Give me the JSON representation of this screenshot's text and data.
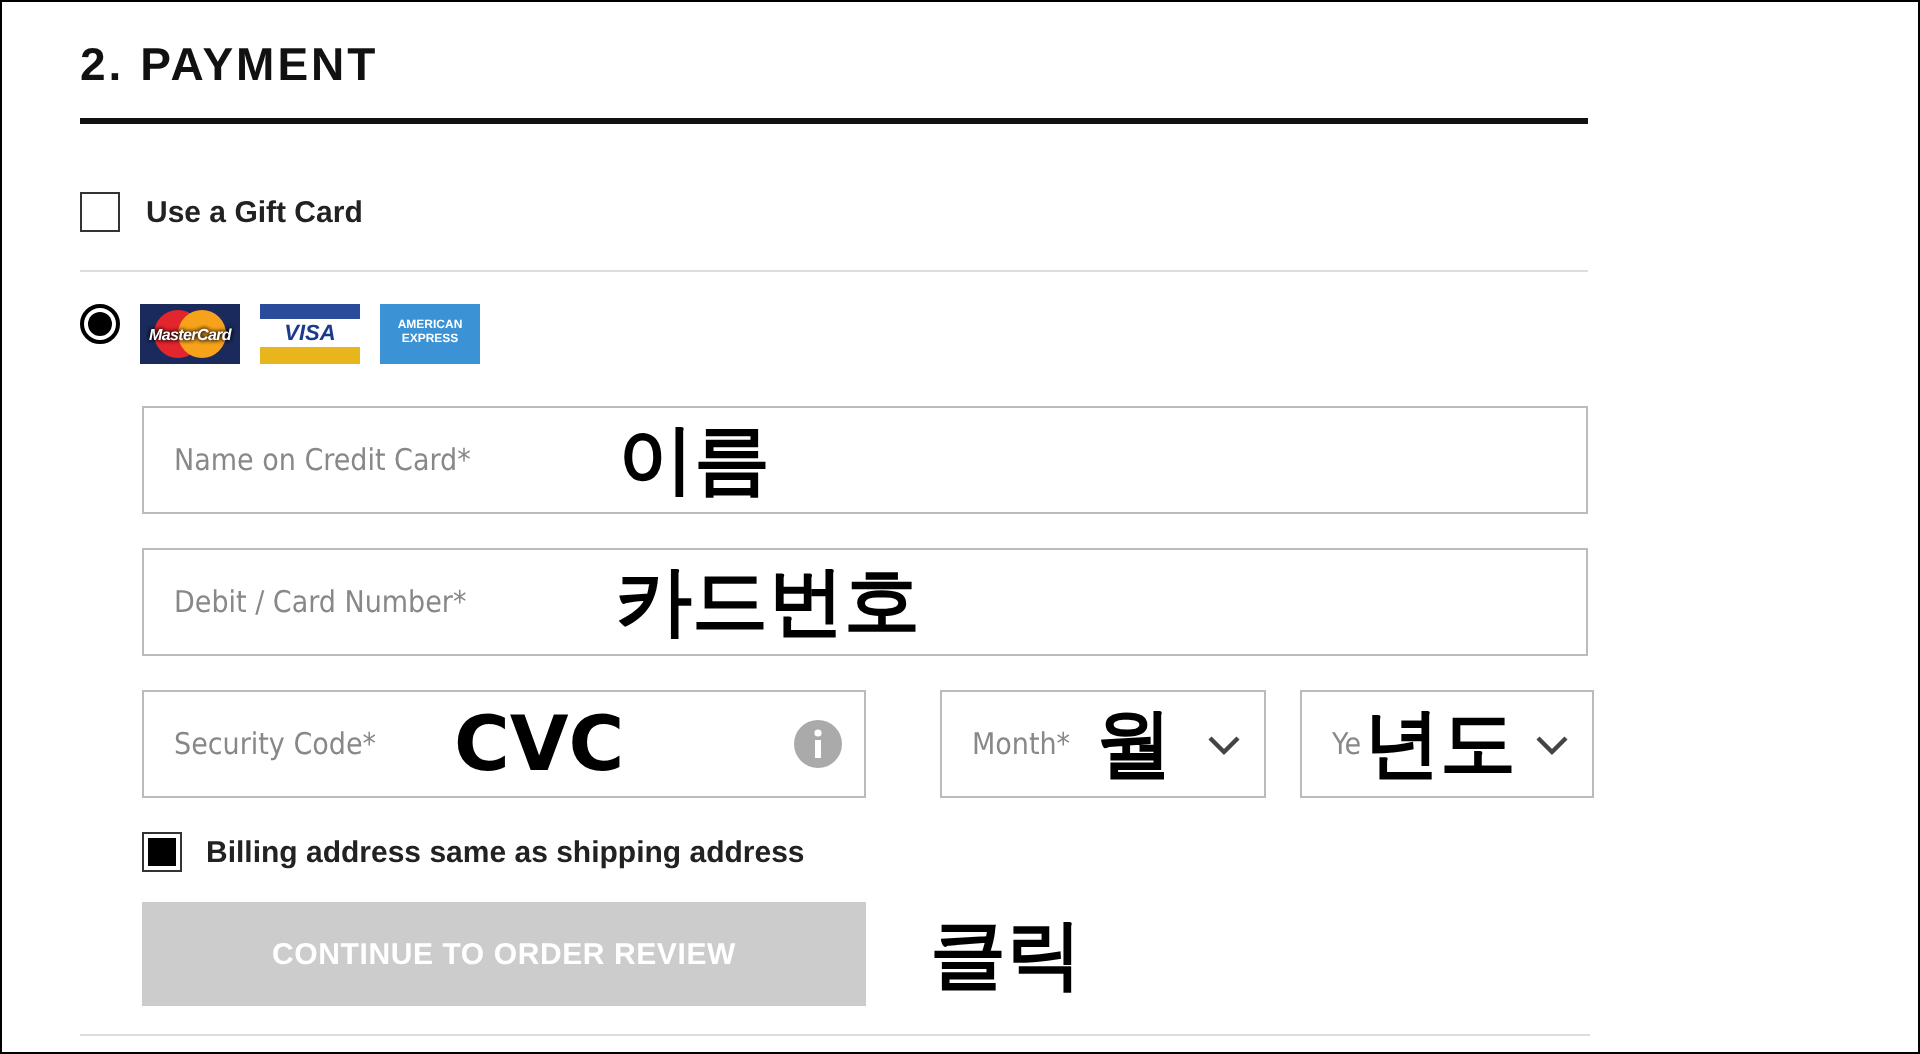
{
  "section": {
    "title": "2. PAYMENT"
  },
  "gift_card": {
    "label": "Use a Gift Card",
    "checked": false
  },
  "card_payment": {
    "selected": true,
    "cards": [
      {
        "kind": "mastercard",
        "label": "MasterCard"
      },
      {
        "kind": "visa",
        "label": "VISA"
      },
      {
        "kind": "amex",
        "label": "AMERICAN EXPRESS"
      }
    ]
  },
  "fields": [
    {
      "kind": "text",
      "placeholder": "Name on Credit Card*",
      "annotation": "이름"
    },
    {
      "kind": "text",
      "placeholder": "Debit / Card Number*",
      "annotation": "카드번호"
    },
    {
      "kind": "text_info",
      "placeholder": "Security Code*",
      "annotation": "CVC"
    },
    {
      "kind": "select",
      "placeholder": "Month*",
      "annotation": "월"
    },
    {
      "kind": "select",
      "placeholder": "Ye",
      "annotation": "년도"
    }
  ],
  "billing_same": {
    "label": "Billing address same as shipping address",
    "checked": true
  },
  "continue_button": {
    "label": "CONTINUE TO ORDER REVIEW",
    "disabled": true,
    "annotation": "클릭"
  }
}
